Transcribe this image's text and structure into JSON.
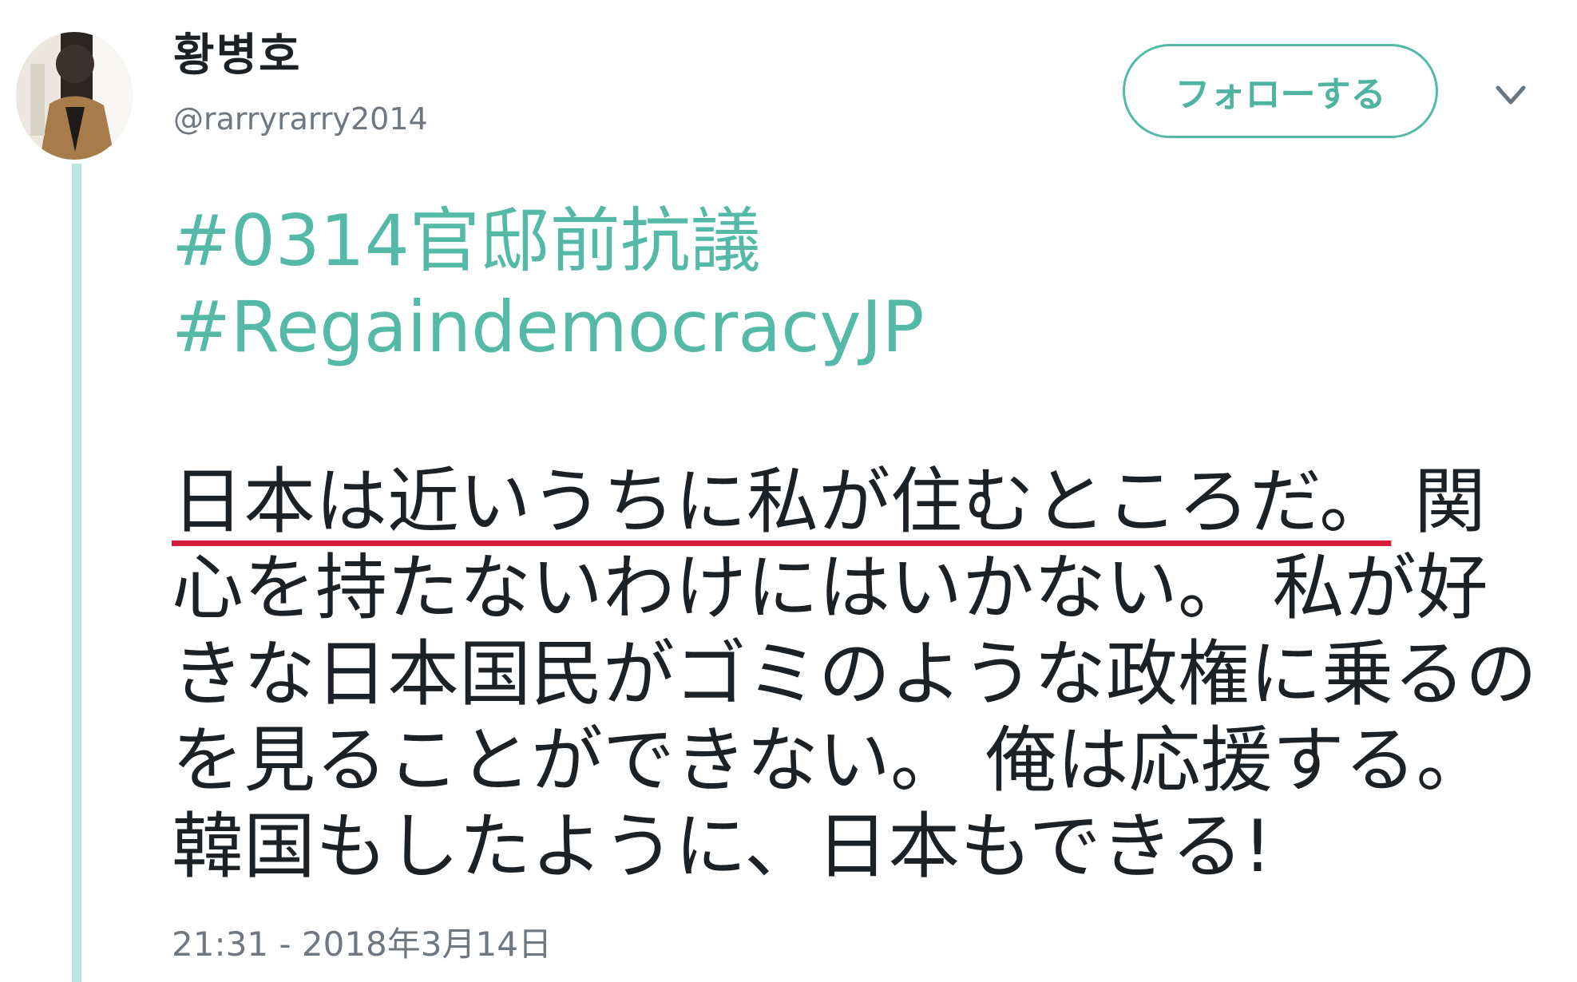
{
  "user": {
    "display_name": "황병호",
    "handle": "@rarryrarry2014"
  },
  "follow_button_label": "フォローする",
  "more_menu_icon": "chevron-down-icon",
  "hashtags": [
    "#0314官邸前抗議",
    "#RegaindemocracyJP"
  ],
  "tweet": {
    "highlighted_text": "日本は近いうちに私が住むところだ。",
    "remaining_text": " 関心を持たないわけにはいかない。 私が好きな日本国民がゴミのような政権に乗るのを見ることができない。 俺は応援する。 韓国もしたように、日本もできる!"
  },
  "timestamp": "21:31 - 2018年3月14日",
  "colors": {
    "accent": "#55b9a7",
    "underline": "#d51f3a",
    "thread_line": "#b8e6dd",
    "text": "#1c2126",
    "muted": "#6f7780"
  }
}
